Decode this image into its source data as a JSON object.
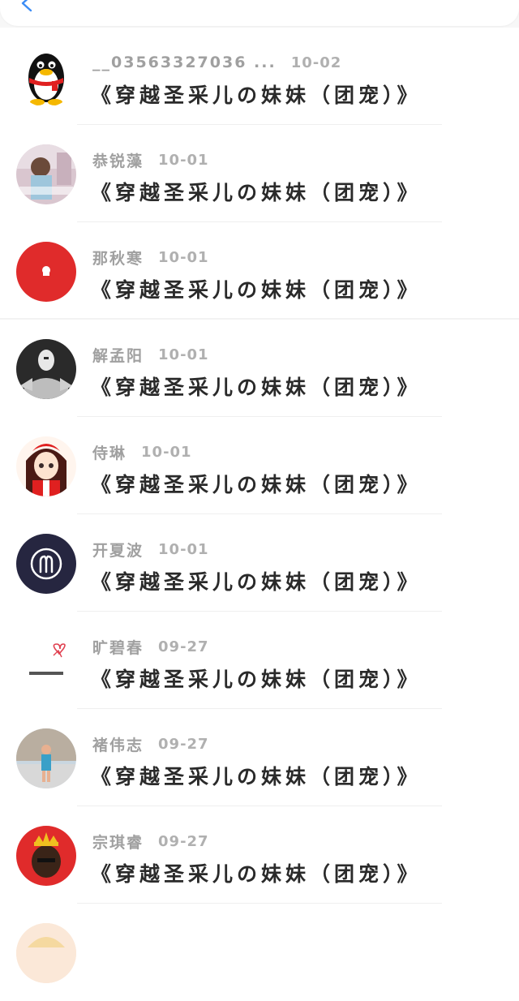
{
  "header": {
    "back_icon": "chevron-left-icon",
    "accent": "#3b8cf5"
  },
  "comments": [
    {
      "name": "__03563327036 ...",
      "date": "10-02",
      "title": "《穿越圣采儿の妹妹（团宠）》",
      "avatar": "qq-penguin"
    },
    {
      "name": "恭锐藻",
      "date": "10-01",
      "title": "《穿越圣采儿の妹妹（团宠）》",
      "avatar": "photo-girl"
    },
    {
      "name": "那秋寒",
      "date": "10-01",
      "title": "《穿越圣采儿の妹妹（团宠）》",
      "avatar": "red-circle"
    },
    {
      "name": "解孟阳",
      "date": "10-01",
      "title": "《穿越圣采儿の妹妹（团宠）》",
      "avatar": "bw-photo"
    },
    {
      "name": "侍琳",
      "date": "10-01",
      "title": "《穿越圣采儿の妹妹（团宠）》",
      "avatar": "anime-girl"
    },
    {
      "name": "开夏波",
      "date": "10-01",
      "title": "《穿越圣采儿の妹妹（团宠）》",
      "avatar": "aries-symbol"
    },
    {
      "name": "旷碧春",
      "date": "09-27",
      "title": "《穿越圣采儿の妹妹（团宠）》",
      "avatar": "doodle-hearts"
    },
    {
      "name": "褚伟志",
      "date": "09-27",
      "title": "《穿越圣采儿の妹妹（团宠）》",
      "avatar": "street-photo"
    },
    {
      "name": "宗琪睿",
      "date": "09-27",
      "title": "《穿越圣采儿の妹妹（团宠）》",
      "avatar": "crown-portrait"
    }
  ]
}
